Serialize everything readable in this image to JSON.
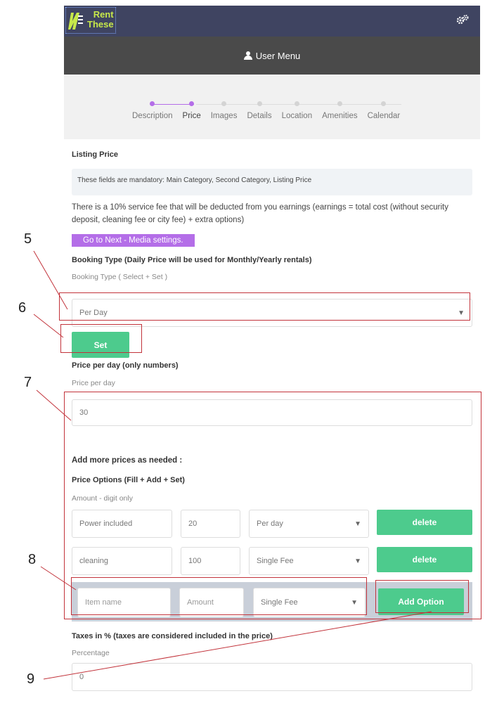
{
  "header": {
    "logo_line1": "Rent",
    "logo_line2": "These",
    "settings_icon": "gears-icon"
  },
  "user_menu": {
    "label": "User Menu",
    "icon": "user-icon"
  },
  "steps": [
    {
      "label": "Description",
      "state": "done"
    },
    {
      "label": "Price",
      "state": "active"
    },
    {
      "label": "Images",
      "state": "todo"
    },
    {
      "label": "Details",
      "state": "todo"
    },
    {
      "label": "Location",
      "state": "todo"
    },
    {
      "label": "Amenities",
      "state": "todo"
    },
    {
      "label": "Calendar",
      "state": "todo"
    }
  ],
  "listing": {
    "title": "Listing Price",
    "notice": "These fields are mandatory: Main Category, Second Category, Listing Price",
    "fee_text": "There is a 10% service fee that will be deducted from you earnings (earnings = total cost (without security deposit, cleaning fee or city fee) + extra options)",
    "next_button": "Go to Next - Media settings."
  },
  "booking": {
    "title": "Booking Type (Daily Price will be used for Monthly/Yearly rentals)",
    "sublabel": "Booking Type ( Select + Set )",
    "selected": "Per Day",
    "set_button": "Set"
  },
  "price": {
    "title": "Price per day (only numbers)",
    "sublabel": "Price per day",
    "value": "30"
  },
  "options": {
    "heading": "Add more prices as needed :",
    "title": "Price Options (Fill + Add + Set)",
    "sublabel": "Amount - digit only",
    "rows": [
      {
        "name": "Power included",
        "amount": "20",
        "type": "Per day",
        "button": "delete"
      },
      {
        "name": "cleaning",
        "amount": "100",
        "type": "Single Fee",
        "button": "delete"
      }
    ],
    "new_row": {
      "name_placeholder": "Item name",
      "amount_placeholder": "Amount",
      "type": "Single Fee",
      "button": "Add Option"
    }
  },
  "taxes": {
    "title": "Taxes in % (taxes are considered included in the price)",
    "sublabel": "Percentage",
    "value": "0"
  },
  "callouts": [
    "5",
    "6",
    "7",
    "8",
    "9"
  ],
  "colors": {
    "topbar": "#3f4461",
    "usermenu": "#4a4a4a",
    "accent_purple": "#b46ee8",
    "accent_green": "#4dcb8d",
    "annotation_red": "#c2333b"
  }
}
